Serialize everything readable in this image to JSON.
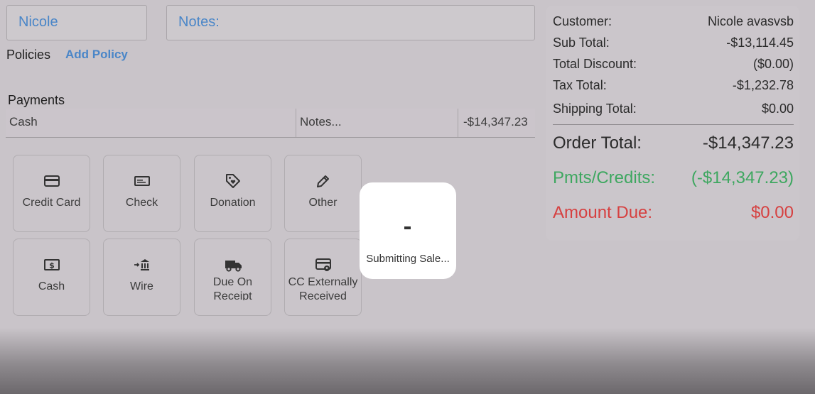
{
  "customer_field": {
    "value": "Nicole"
  },
  "notes_field": {
    "value": "Notes:"
  },
  "policies": {
    "label": "Policies",
    "add_label": "Add Policy"
  },
  "payments": {
    "title": "Payments",
    "row": {
      "method": "Cash",
      "notes": "Notes...",
      "amount": "-$14,347.23"
    }
  },
  "payment_tiles": [
    {
      "label": "Credit Card",
      "icon": "credit-card-icon"
    },
    {
      "label": "Check",
      "icon": "check-icon"
    },
    {
      "label": "Donation",
      "icon": "donation-tag-icon"
    },
    {
      "label": "Other",
      "icon": "pencil-icon"
    },
    {
      "label": "Cash",
      "icon": "cash-icon"
    },
    {
      "label": "Wire",
      "icon": "bank-icon"
    },
    {
      "label": "Due On Receipt",
      "icon": "truck-icon"
    },
    {
      "label": "CC Externally Received",
      "icon": "card-pin-icon"
    }
  ],
  "summary": {
    "customer": {
      "label": "Customer:",
      "value": "Nicole avasvsb"
    },
    "sub_total": {
      "label": "Sub Total:",
      "value": "-$13,114.45"
    },
    "total_discount": {
      "label": "Total Discount:",
      "value": "($0.00)"
    },
    "tax_total": {
      "label": "Tax Total:",
      "value": "-$1,232.78"
    },
    "shipping_total": {
      "label": "Shipping Total:",
      "value": "$0.00"
    },
    "order_total": {
      "label": "Order Total:",
      "value": "-$14,347.23"
    },
    "pmts_credits": {
      "label": "Pmts/Credits:",
      "value": "(-$14,347.23)"
    },
    "amount_due": {
      "label": "Amount Due:",
      "value": "$0.00"
    }
  },
  "modal": {
    "message": "Submitting Sale..."
  },
  "colors": {
    "accent_blue": "#4a86c8",
    "green": "#3ea760",
    "red": "#d64040"
  }
}
